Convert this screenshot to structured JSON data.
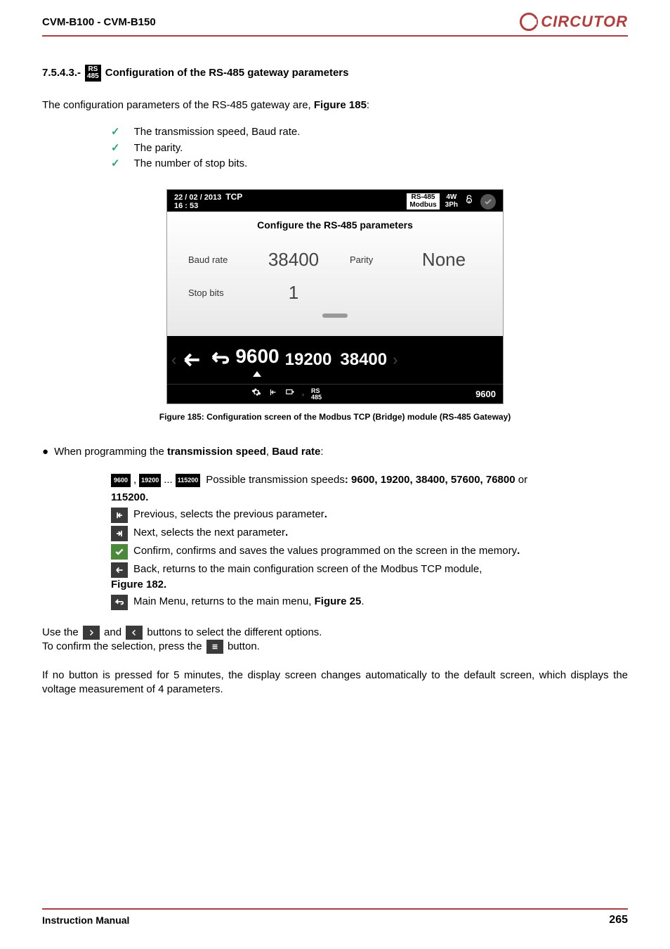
{
  "header": {
    "model": "CVM-B100 - CVM-B150",
    "brand": "CIRCUTOR"
  },
  "section": {
    "number": "7.5.4.3.-",
    "badge_top": "RS",
    "badge_bottom": "485",
    "title": " Configuration of the RS-485 gateway parameters"
  },
  "intro_prefix": "The configuration parameters of the RS-485 gateway are, ",
  "intro_figure": "Figure 185",
  "intro_suffix": ":",
  "checklist": [
    "The transmission speed, Baud rate.",
    "The parity.",
    "The number of stop bits."
  ],
  "device": {
    "date": "22 / 02 / 2013",
    "time": "16 : 53",
    "tcp": "TCP",
    "rs485_top": "RS-485",
    "rs485_bottom": "Modbus",
    "wires": "4W",
    "phase": "3Ph",
    "body_title": "Configure the RS-485 parameters",
    "baud_label": "Baud rate",
    "baud_value": "38400",
    "parity_label": "Parity",
    "parity_value": "None",
    "stop_label": "Stop bits",
    "stop_value": "1",
    "selector_current": "9600",
    "selector_opt1": "19200",
    "selector_opt2": "38400",
    "crumb_rs": "RS",
    "crumb_485": "485",
    "bottom_right": "9600"
  },
  "figcap": "Figure 185: Configuration screen of the Modbus TCP (Bridge) module (RS-485 Gateway)",
  "prog_line_prefix": "When programming the ",
  "prog_line_b1": "transmission speed",
  "prog_line_mid": ", ",
  "prog_line_b2": "Baud rate",
  "prog_line_suffix": ":",
  "chips": {
    "c1": "9600",
    "c2": "19200",
    "dots": "...",
    "c3": "115200"
  },
  "speeds_prefix": "  Possible transmission speeds",
  "speeds_bold": ": 9600, 19200, 38400, 57600, 76800",
  "speeds_suffix": " or ",
  "speeds_last": "115200.",
  "prev_text_a": " Previous, selects the previous parameter",
  "next_text_a": " Next, selects the next parameter",
  "confirm_text": "  Confirm,  confirms  and  saves  the  values  programmed  on  the  screen  in  the memory",
  "back_text": " Back, returns to the main configuration screen of the Modbus TCP module,",
  "back_fig": "Figure 182.",
  "main_text_a": " Main Menu, returns to the main menu, ",
  "main_fig": "Figure 25",
  "use_line_a": "Use the ",
  "use_line_b": " and ",
  "use_line_c": " buttons to select the different options.",
  "confirm_sel_a": "To confirm the selection, press the ",
  "confirm_sel_b": " button.",
  "timeout": "If no button is pressed for 5 minutes, the display screen changes automatically to the default screen, which displays the voltage measurement of 4 parameters.",
  "footer": {
    "left": "Instruction Manual",
    "page": "265"
  }
}
